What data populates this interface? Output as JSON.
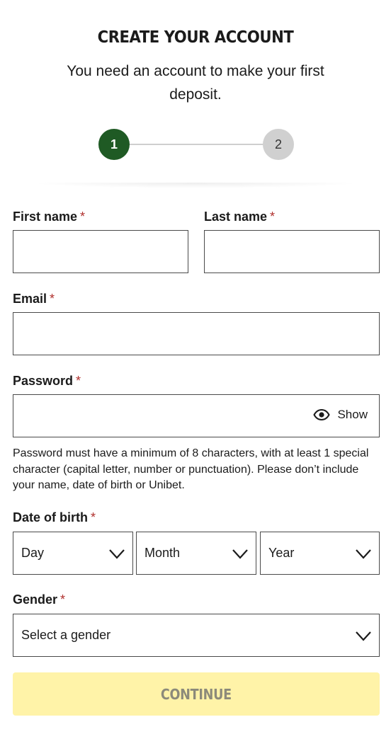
{
  "header": {
    "title": "CREATE YOUR ACCOUNT",
    "subtitle": "You need an account to make your first deposit."
  },
  "stepper": {
    "steps": [
      {
        "label": "1",
        "active": true
      },
      {
        "label": "2",
        "active": false
      }
    ],
    "colors": {
      "active": "#1f5a24",
      "inactive": "#d0d0d0"
    }
  },
  "form": {
    "required_marker": "*",
    "first_name": {
      "label": "First name",
      "value": "",
      "placeholder": ""
    },
    "last_name": {
      "label": "Last name",
      "value": "",
      "placeholder": ""
    },
    "email": {
      "label": "Email",
      "value": "",
      "placeholder": ""
    },
    "password": {
      "label": "Password",
      "value": "",
      "placeholder": "",
      "show_label": "Show",
      "show_icon": "eye-icon",
      "hint": "Password must have a minimum of 8 characters, with at least 1 special character (capital letter, number or punctuation). Please don’t include your name, date of birth or Unibet."
    },
    "date_of_birth": {
      "label": "Date of birth",
      "day": "Day",
      "month": "Month",
      "year": "Year",
      "dropdown_icon": "chevron-down-icon"
    },
    "gender": {
      "label": "Gender",
      "selected": "Select a gender",
      "dropdown_icon": "chevron-down-icon"
    },
    "continue_label": "CONTINUE"
  },
  "colors": {
    "required": "#b0302d",
    "continue_bg": "#fff3a8",
    "continue_text": "#8c8a7a"
  }
}
